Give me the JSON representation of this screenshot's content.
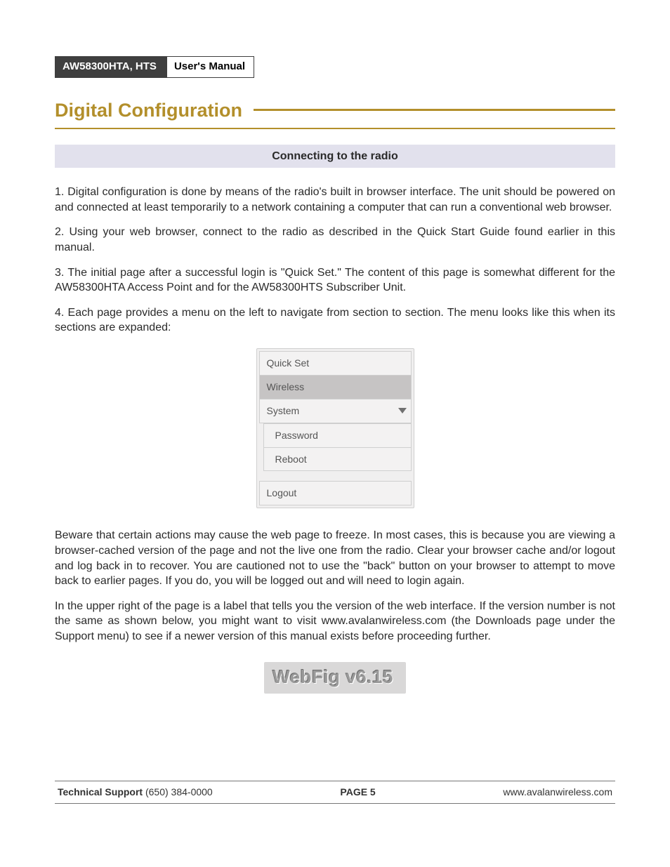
{
  "header": {
    "model_badge": "AW58300HTA, HTS",
    "doc_badge": "User's Manual"
  },
  "section_title": "Digital Configuration",
  "subtitle": "Connecting to the radio",
  "paragraphs": {
    "p1": "1. Digital configuration is done by means of the radio's built in browser interface. The unit should be powered on and connected at least temporarily to a network containing a computer that can run a conventional web browser.",
    "p2": "2. Using your web browser, connect to the radio as described in the Quick Start Guide found earlier in this manual.",
    "p3": "3. The initial page after a successful login is \"Quick Set.\" The content of this page is somewhat different for the AW58300HTA Access Point and for the AW58300HTS Subscriber Unit.",
    "p4": "4. Each page provides a menu on the left to navigate from section to section. The menu looks like this when its sections are expanded:",
    "p5": "Beware that certain actions may cause the web page to freeze. In most cases, this is because you are viewing a browser-cached version of the page and not the live one from the radio. Clear your browser cache and/or logout and log back in to recover. You are cautioned not to use the \"back\" button on your browser to attempt to move back to earlier pages. If you do, you will be logged out and will need to login again.",
    "p6": "In the upper right of the page is a label that tells you the version of the web interface. If the version number is not the same as shown below, you might want to visit www.avalanwireless.com (the Downloads page under the Support menu) to see if a newer version of this manual exists before proceeding further."
  },
  "menu": {
    "items": [
      "Quick Set",
      "Wireless",
      "System",
      "Password",
      "Reboot",
      "Logout"
    ]
  },
  "version_label": "WebFig v6.15",
  "footer": {
    "support_label": "Technical Support",
    "support_phone": "(650) 384-0000",
    "page_label": "PAGE 5",
    "url": "www.avalanwireless.com"
  }
}
